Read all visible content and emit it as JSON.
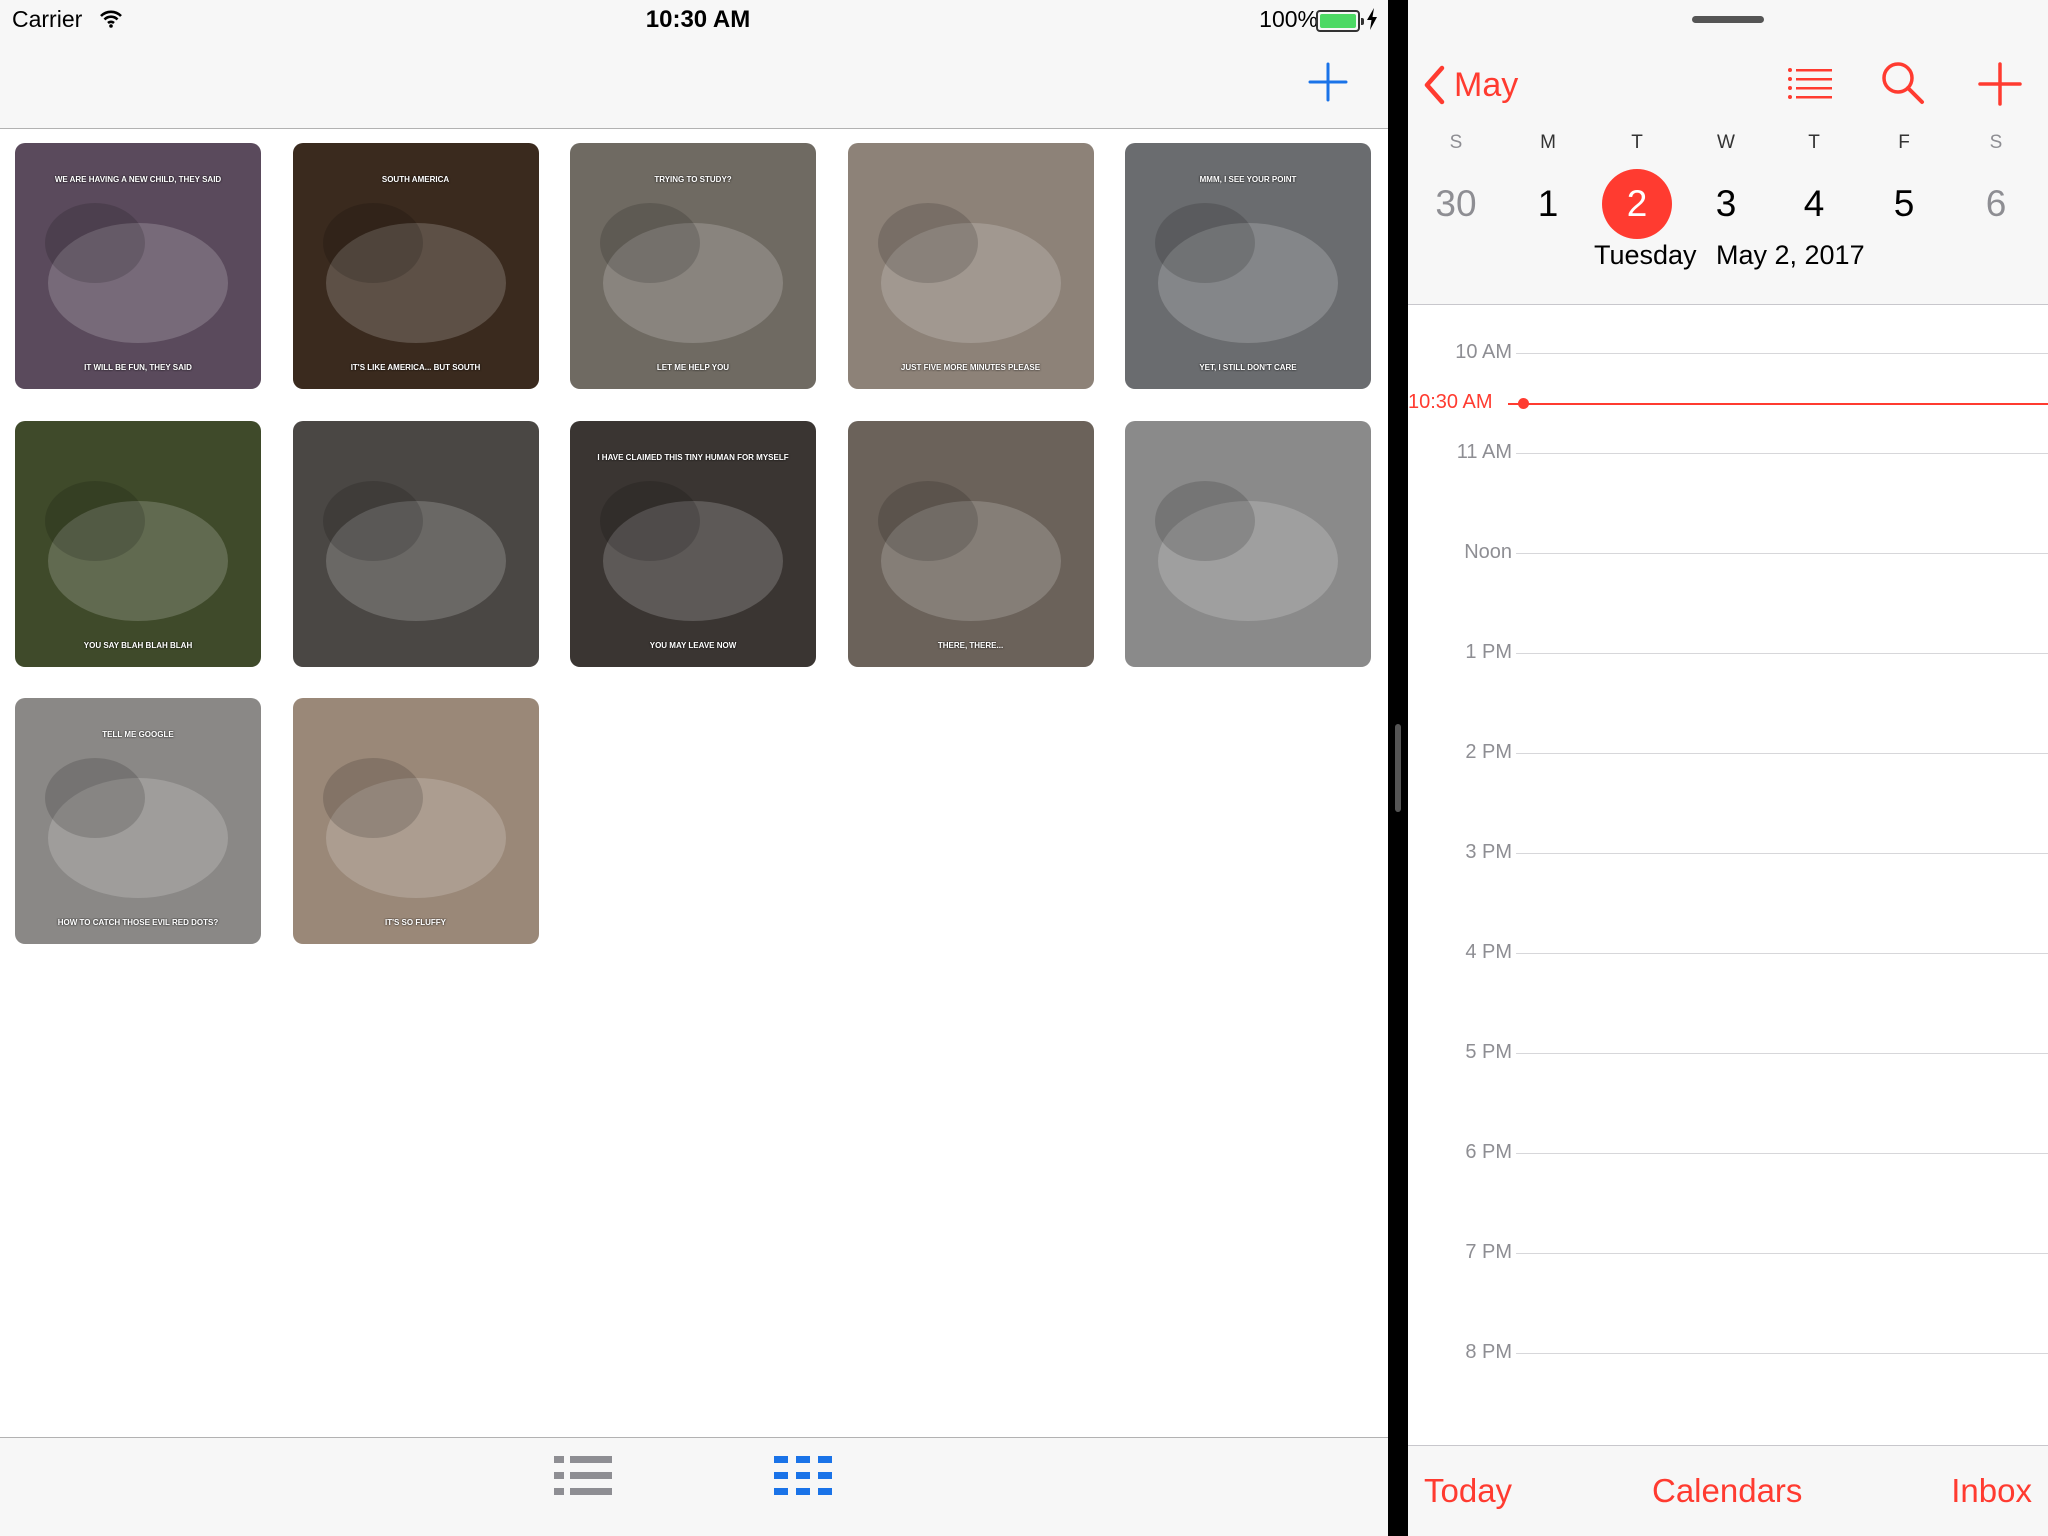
{
  "status_bar": {
    "carrier": "Carrier",
    "time": "10:30 AM",
    "battery": "100%"
  },
  "left_app": {
    "add_icon": "plus-icon",
    "accent": "#1a73e8",
    "tiles": [
      {
        "top": "WE ARE HAVING A NEW CHILD, THEY SAID",
        "bottom": "IT WILL BE FUN, THEY SAID",
        "bg": "#5a4a5c"
      },
      {
        "top": "SOUTH AMERICA",
        "bottom": "IT'S LIKE AMERICA... BUT SOUTH",
        "bg": "#3a2a1e"
      },
      {
        "top": "TRYING TO STUDY?",
        "bottom": "LET ME HELP YOU",
        "bg": "#6f6a62"
      },
      {
        "top": "",
        "bottom": "JUST FIVE MORE MINUTES PLEASE",
        "bg": "#8d8278"
      },
      {
        "top": "MMM, I SEE YOUR POINT",
        "bottom": "YET, I STILL DON'T CARE",
        "bg": "#6a6c6f"
      },
      {
        "top": "",
        "bottom": "YOU SAY BLAH BLAH BLAH",
        "bg": "#3f4a2a"
      },
      {
        "top": "",
        "bottom": "",
        "bg": "#4a4744"
      },
      {
        "top": "I HAVE CLAIMED THIS TINY HUMAN FOR MYSELF",
        "bottom": "YOU MAY LEAVE NOW",
        "bg": "#3a3532"
      },
      {
        "top": "",
        "bottom": "THERE, THERE...",
        "bg": "#6b625a"
      },
      {
        "top": "",
        "bottom": "",
        "bg": "#8a8a8a"
      },
      {
        "top": "TELL ME GOOGLE",
        "bottom": "HOW TO CATCH THOSE EVIL RED DOTS?",
        "bg": "#8a8886"
      },
      {
        "top": "",
        "bottom": "IT'S SO FLUFFY",
        "bg": "#9a8878"
      }
    ],
    "tabs": [
      {
        "name": "list-view-tab",
        "icon": "list-icon",
        "color": "#8e8e93"
      },
      {
        "name": "grid-view-tab",
        "icon": "grid-icon",
        "color": "#1a73e8"
      }
    ]
  },
  "calendar": {
    "accent": "#ff3b30",
    "back_label": "May",
    "weekdays": [
      "S",
      "M",
      "T",
      "W",
      "T",
      "F",
      "S"
    ],
    "days": [
      "30",
      "1",
      "2",
      "3",
      "4",
      "5",
      "6"
    ],
    "selected_index": 2,
    "selected_day_name": "Tuesday",
    "selected_date": "May 2, 2017",
    "hours": [
      "10 AM",
      "11 AM",
      "Noon",
      "1 PM",
      "2 PM",
      "3 PM",
      "4 PM",
      "5 PM",
      "6 PM",
      "7 PM",
      "8 PM"
    ],
    "now_label": "10:30 AM",
    "tabs": {
      "today": "Today",
      "calendars": "Calendars",
      "inbox": "Inbox"
    }
  }
}
